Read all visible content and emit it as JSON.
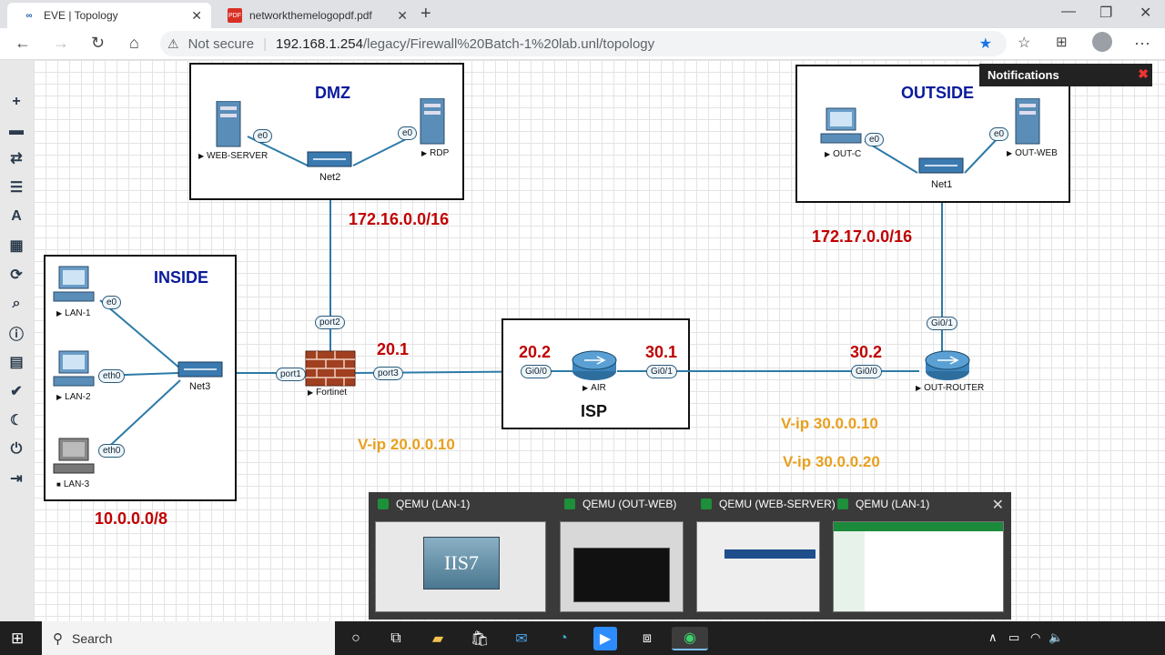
{
  "browser": {
    "tabs": [
      {
        "title": "EVE | Topology",
        "active": true,
        "icon": "eve-icon"
      },
      {
        "title": "networkthemelogopdf.pdf",
        "active": false,
        "icon": "pdf-icon"
      }
    ],
    "address": {
      "security_label": "Not secure",
      "host": "192.168.1.254",
      "path": "/legacy/Firewall%20Batch-1%20lab.unl/topology"
    }
  },
  "notification": {
    "title": "Notifications"
  },
  "topology": {
    "zones": {
      "dmz": "DMZ",
      "outside": "OUTSIDE",
      "inside": "INSIDE",
      "isp": "ISP"
    },
    "networks": {
      "dmz_net": "172.16.0.0/16",
      "outside_net": "172.17.0.0/16",
      "inside_net": "10.0.0.0/8"
    },
    "ips": {
      "fw_port3": "20.1",
      "air_gi00": "20.2",
      "air_gi01": "30.1",
      "router_gi00": "30.2"
    },
    "vips": [
      "V-ip 20.0.0.10",
      "V-ip 30.0.0.10",
      "V-ip 30.0.0.20"
    ],
    "nodes": {
      "web_server": "WEB-SERVER",
      "rdp": "RDP",
      "net2": "Net2",
      "out_c": "OUT-C",
      "out_web": "OUT-WEB",
      "net1": "Net1",
      "lan1": "LAN-1",
      "lan2": "LAN-2",
      "lan3": "LAN-3",
      "net3": "Net3",
      "fortinet": "Fortinet",
      "air": "AIR",
      "out_router": "OUT-ROUTER"
    },
    "ports": {
      "web_e0": "e0",
      "rdp_e0": "e0",
      "outc_e0": "e0",
      "outweb_e0": "e0",
      "lan1_e0": "e0",
      "lan2_eth0": "eth0",
      "lan3_eth0": "eth0",
      "fw_port1": "port1",
      "fw_port2": "port2",
      "fw_port3": "port3",
      "air_gi00": "Gi0/0",
      "air_gi01": "Gi0/1",
      "rtr_gi00": "Gi0/0",
      "rtr_gi01": "Gi0/1"
    }
  },
  "qemu_windows": [
    {
      "title": "QEMU (LAN-1)",
      "thumb_text": "IIS7"
    },
    {
      "title": "QEMU (OUT-WEB)"
    },
    {
      "title": "QEMU (WEB-SERVER)"
    },
    {
      "title": "QEMU (LAN-1)"
    }
  ],
  "taskbar": {
    "search_label": "Search"
  },
  "colors": {
    "zone_label": "#0a1a9c",
    "net_label": "#c00000",
    "vip_label": "#e8a020",
    "link": "#2d7aa8"
  }
}
